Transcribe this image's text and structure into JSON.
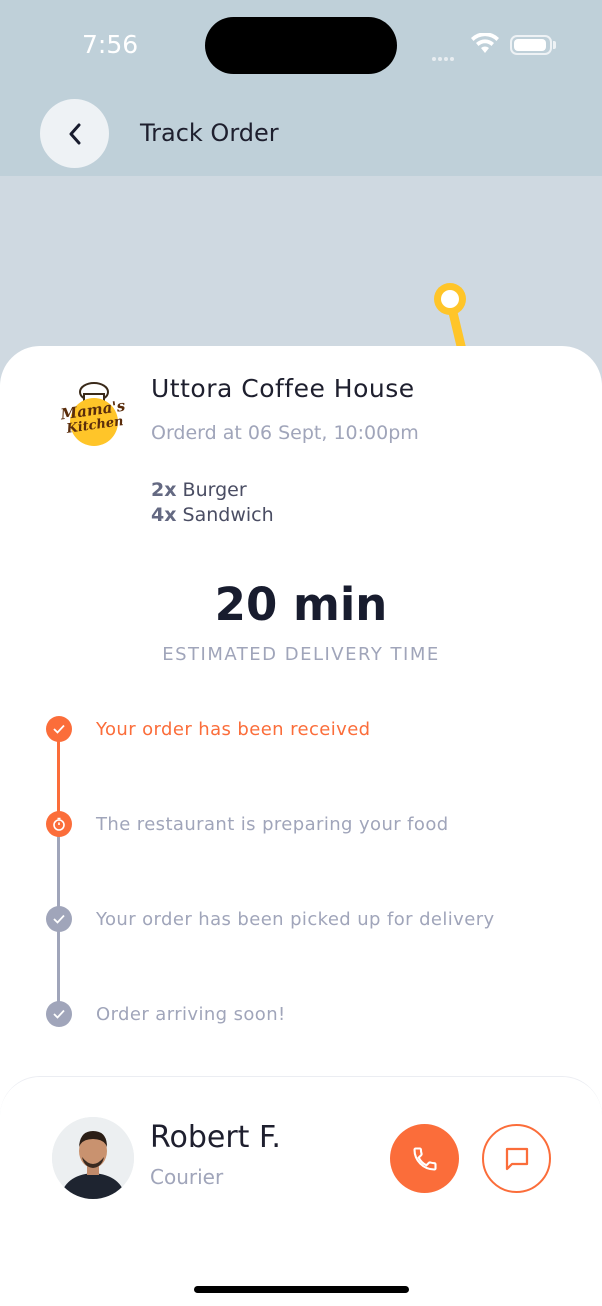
{
  "status_bar": {
    "time": "7:56"
  },
  "header": {
    "title": "Track Order"
  },
  "restaurant": {
    "name": "Uttora Coffee House",
    "ordered_at": "Orderd at 06 Sept, 10:00pm",
    "logo_text_line1": "Mama's",
    "logo_text_line2": "Kitchen"
  },
  "items": [
    {
      "qty": "2x",
      "name": "Burger"
    },
    {
      "qty": "4x",
      "name": "Sandwich"
    }
  ],
  "eta": {
    "value": "20 min",
    "label": "ESTIMATED DELIVERY TIME"
  },
  "steps": [
    {
      "text": "Your order has been received",
      "state": "done"
    },
    {
      "text": "The restaurant is preparing your food",
      "state": "current"
    },
    {
      "text": "Your order has been picked up for delivery",
      "state": "pending"
    },
    {
      "text": "Order arriving soon!",
      "state": "pending"
    }
  ],
  "courier": {
    "name": "Robert F.",
    "role": "Courier"
  },
  "colors": {
    "accent": "#fb6d3a",
    "pending": "#a0a5ba",
    "map": "#cfd9e1",
    "route": "#ffc529"
  }
}
